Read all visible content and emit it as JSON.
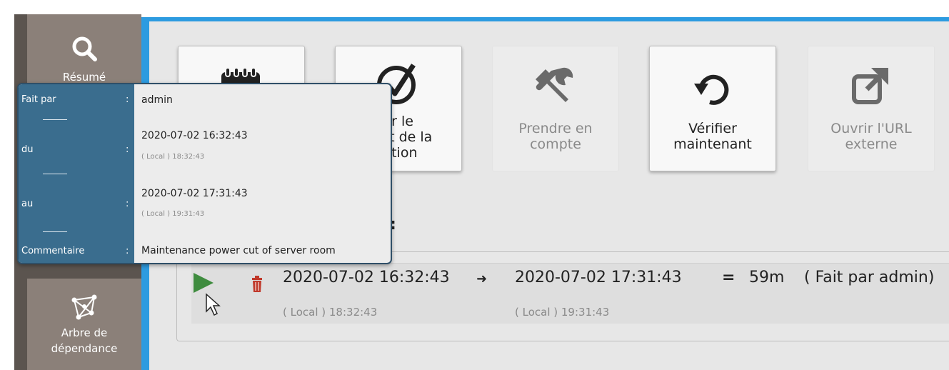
{
  "sidebar": {
    "top_item": {
      "label": "Résumé",
      "icon": "search-icon"
    },
    "bottom_item": {
      "label_line1": "Arbre de",
      "label_line2": "dépendance",
      "icon": "network-icon"
    }
  },
  "actions": [
    {
      "label": "",
      "icon": "calendar-icon",
      "enabled": true
    },
    {
      "label": "cer le\ntat de la\ncation",
      "icon": "check-circle-icon",
      "enabled": true
    },
    {
      "label": "Prendre en\ncompte",
      "icon": "tools-icon",
      "enabled": false
    },
    {
      "label": "Vérifier\nmaintenant",
      "icon": "refresh-icon",
      "enabled": true
    },
    {
      "label": "Ouvrir l'URL\nexterne",
      "icon": "external-link-icon",
      "enabled": false
    }
  ],
  "section": {
    "trailing": ":"
  },
  "downtime": {
    "start": "2020-07-02 16:32:43",
    "start_local": "( Local ) 18:32:43",
    "arrow": "➜",
    "end": "2020-07-02 17:31:43",
    "end_local": "( Local ) 19:31:43",
    "equals": "=",
    "duration": "59m",
    "author": "( Fait par admin)"
  },
  "tooltip": {
    "rows": [
      {
        "label": "Fait par",
        "value": "admin",
        "sub": ""
      },
      {
        "label": "du",
        "value": "2020-07-02 16:32:43",
        "sub": "( Local ) 18:32:43"
      },
      {
        "label": "au",
        "value": "2020-07-02 17:31:43",
        "sub": "( Local ) 19:31:43"
      },
      {
        "label": "Commentaire",
        "value": "Maintenance power cut of server room",
        "sub": ""
      }
    ],
    "colon": ":"
  },
  "colors": {
    "accent": "#2d9be0",
    "sidebar": "#5b544f",
    "tooltip_label_bg": "#3a6d8e",
    "play": "#3f8c3f",
    "delete": "#c0392b"
  }
}
